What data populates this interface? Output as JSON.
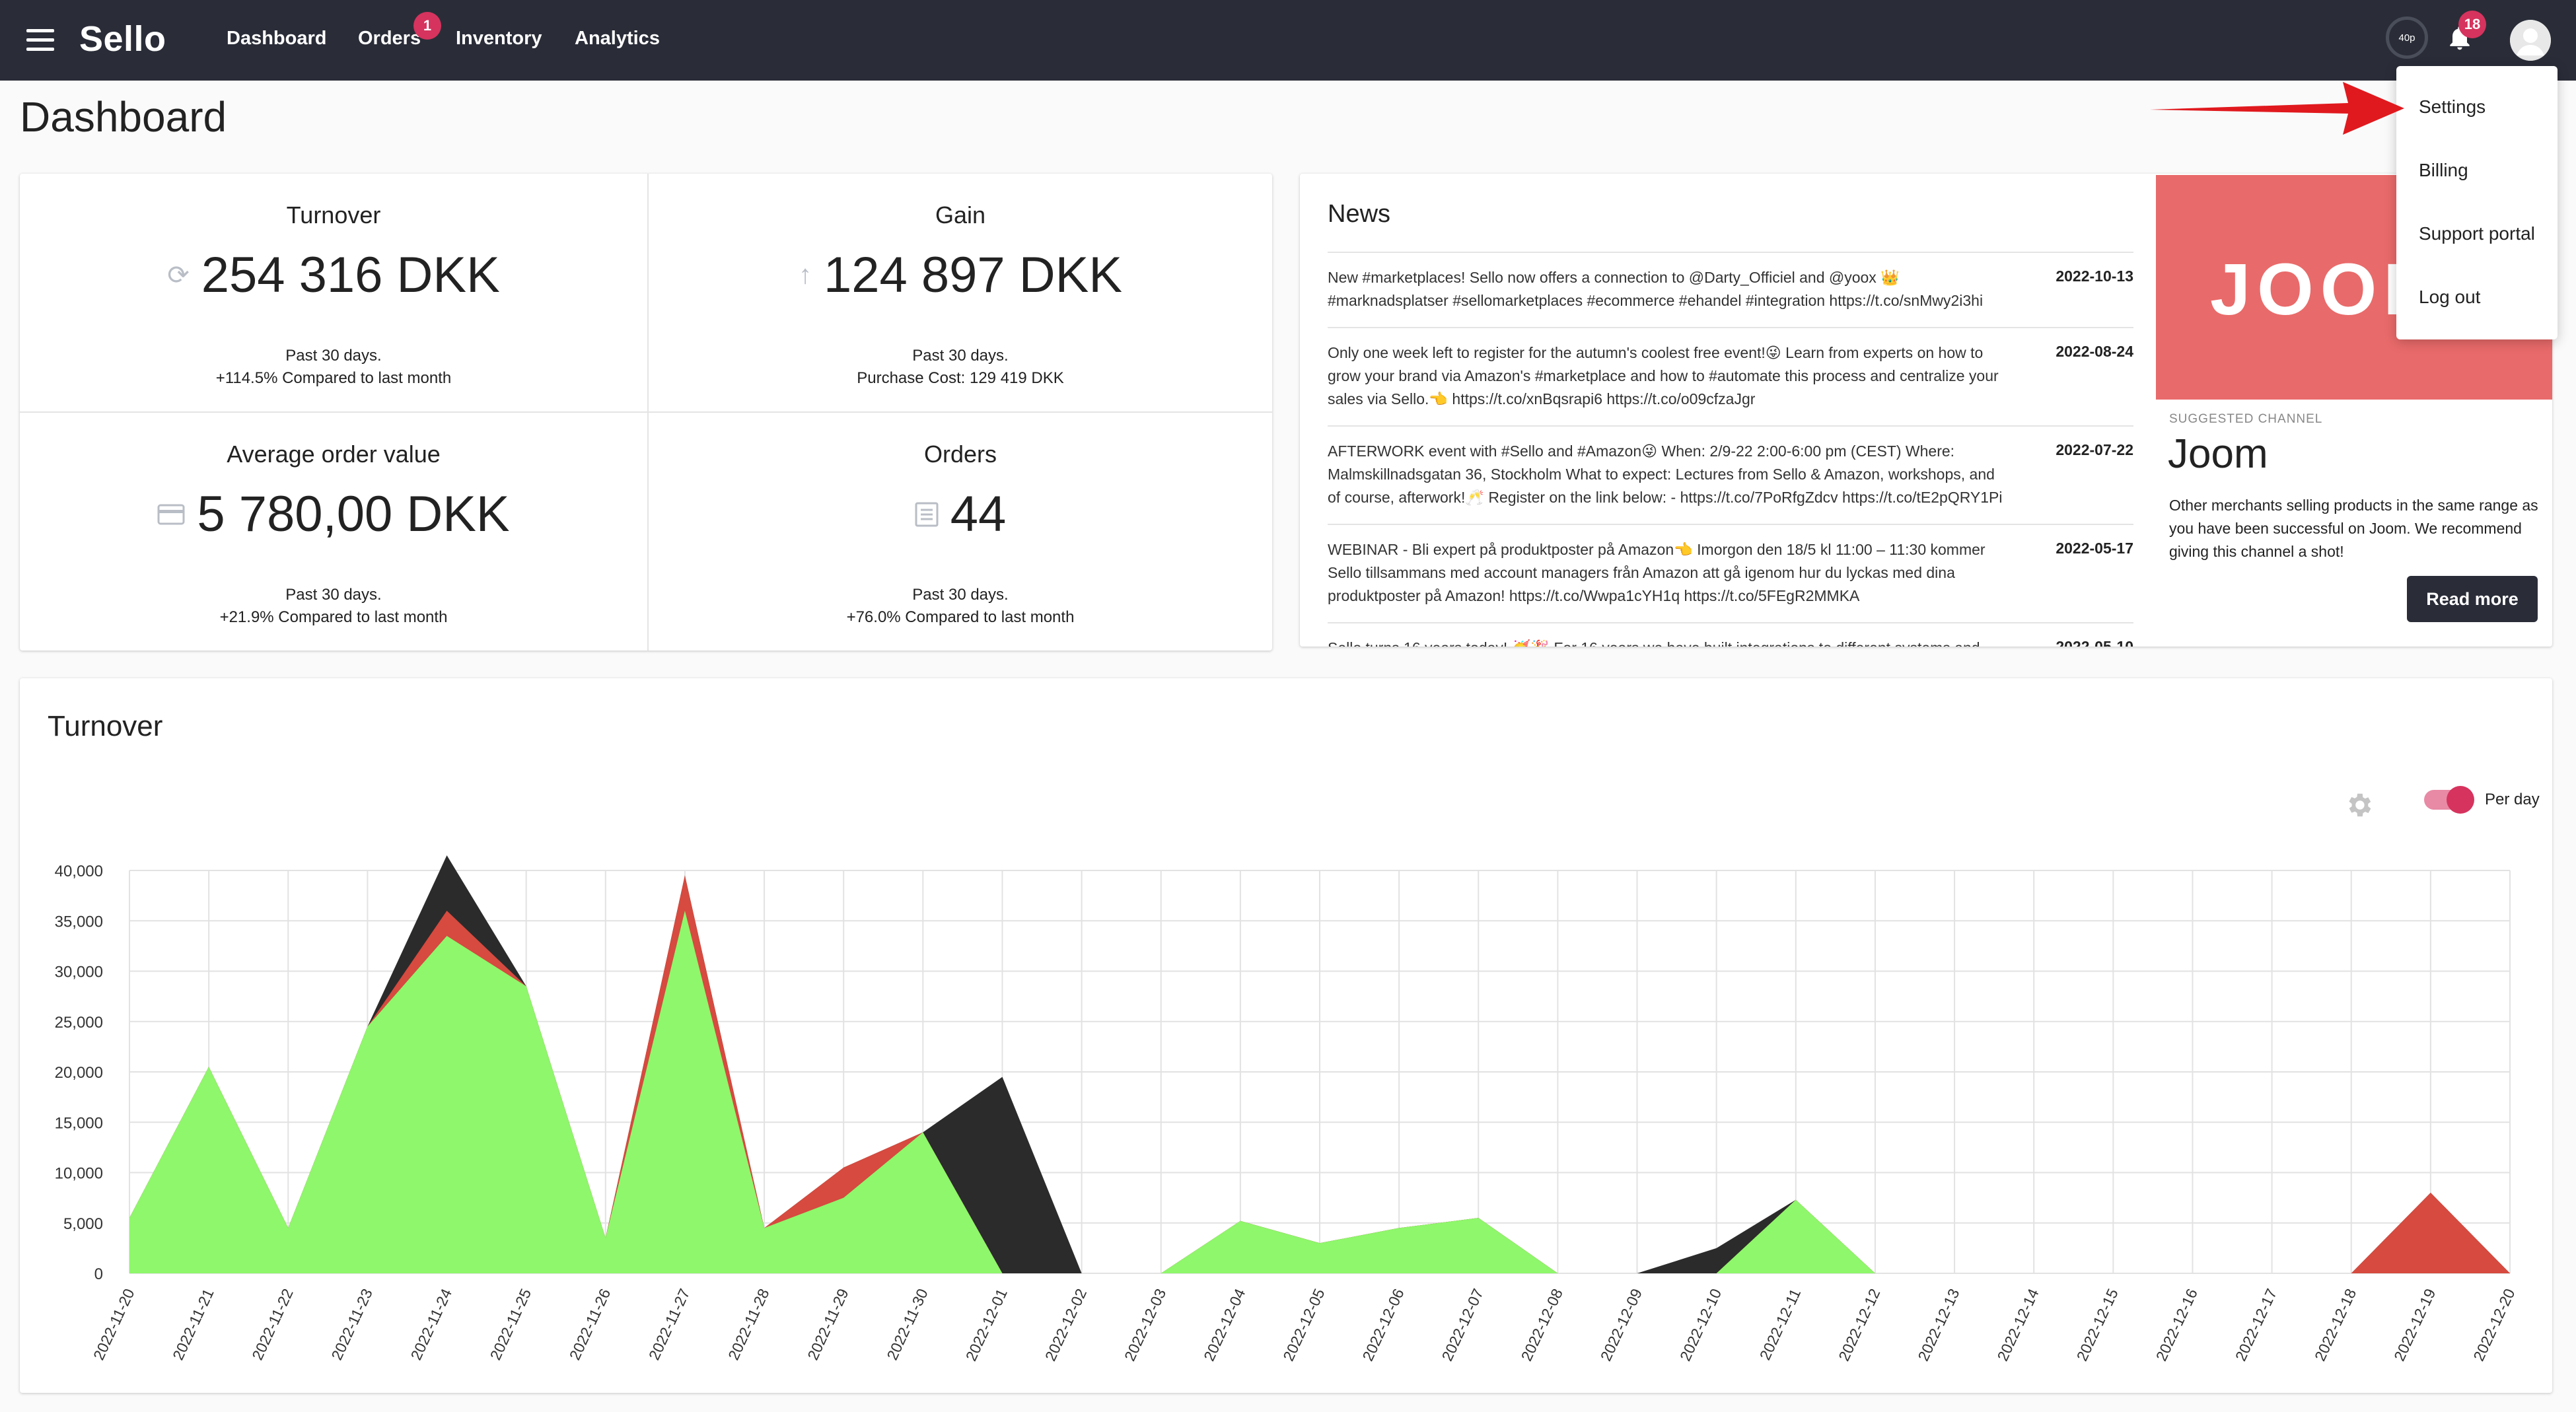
{
  "brand": "Sello",
  "nav": {
    "items": [
      {
        "label": "Dashboard"
      },
      {
        "label": "Orders",
        "badge": "1"
      },
      {
        "label": "Inventory"
      },
      {
        "label": "Analytics"
      }
    ],
    "gauge_label": "40p",
    "notifications_badge": "18"
  },
  "user_menu": {
    "items": [
      {
        "label": "Settings"
      },
      {
        "label": "Billing"
      },
      {
        "label": "Support portal"
      },
      {
        "label": "Log out"
      }
    ]
  },
  "page_title": "Dashboard",
  "stats": [
    {
      "title": "Turnover",
      "value": "254 316 DKK",
      "icon": "refresh-icon",
      "sub1": "Past 30 days.",
      "sub2": "+114.5% Compared to last month"
    },
    {
      "title": "Gain",
      "value": "124 897 DKK",
      "icon": "arrow-up-icon",
      "sub1": "Past 30 days.",
      "sub2": "Purchase Cost: 129 419 DKK"
    },
    {
      "title": "Average order value",
      "value": "5 780,00 DKK",
      "icon": "credit-card-icon",
      "sub1": "Past 30 days.",
      "sub2": "+21.9% Compared to last month"
    },
    {
      "title": "Orders",
      "value": "44",
      "icon": "receipt-icon",
      "sub1": "Past 30 days.",
      "sub2": "+76.0% Compared to last month"
    }
  ],
  "news": {
    "title": "News",
    "items": [
      {
        "text": "New #marketplaces! Sello now offers a connection to @Darty_Officiel and @yoox 👑 #marknadsplatser #sellomarketplaces #ecommerce #ehandel #integration https://t.co/snMwy2i3hi",
        "date": "2022-10-13"
      },
      {
        "text": "Only one week left to register for the autumn's coolest free event!😜 Learn from experts on how to grow your brand via Amazon's #marketplace and how to #automate this process and centralize your sales via Sello.👈 https://t.co/xnBqsrapi6 https://t.co/o09cfzaJgr",
        "date": "2022-08-24"
      },
      {
        "text": "AFTERWORK event with #Sello and #Amazon😜 When: 2/9-22 2:00-6:00 pm (CEST) Where: Malmskillnadsgatan 36, Stockholm What to expect: Lectures from Sello & Amazon, workshops, and of course, afterwork!🥂 Register on the link below: - https://t.co/7PoRfgZdcv https://t.co/tE2pQRY1Pi",
        "date": "2022-07-22"
      },
      {
        "text": "WEBINAR - Bli expert på produktposter på Amazon👈 Imorgon den 18/5 kl 11:00 – 11:30 kommer Sello tillsammans med account managers från Amazon att gå igenom hur du lyckas med dina produktposter på Amazon! https://t.co/Wwpa1cYH1q https://t.co/5FEgR2MMKA",
        "date": "2022-05-17"
      },
      {
        "text": "Sello turns 16 years today! 🥳🎉 For 16 years we have built integrations to different systems and",
        "date": "2022-05-10"
      }
    ]
  },
  "suggested": {
    "banner_text": "JOOM",
    "label": "SUGGESTED CHANNEL",
    "name": "Joom",
    "description": "Other merchants selling products in the same range as you have been successful on Joom. We recommend giving this channel a shot!",
    "button": "Read more"
  },
  "chart_title": "Turnover",
  "toggle_label": "Per day",
  "colors": {
    "nav_bg": "#2a2d38",
    "accent": "#d6335e",
    "green": "#8ef76b",
    "red": "#d64a3f",
    "black": "#2b2b2b",
    "joom": "#e96a6a"
  },
  "chart_data": {
    "type": "area",
    "categories": [
      "2022-11-20",
      "2022-11-21",
      "2022-11-22",
      "2022-11-23",
      "2022-11-24",
      "2022-11-25",
      "2022-11-26",
      "2022-11-27",
      "2022-11-28",
      "2022-11-29",
      "2022-11-30",
      "2022-12-01",
      "2022-12-02",
      "2022-12-03",
      "2022-12-04",
      "2022-12-05",
      "2022-12-06",
      "2022-12-07",
      "2022-12-08",
      "2022-12-09",
      "2022-12-10",
      "2022-12-11",
      "2022-12-12",
      "2022-12-13",
      "2022-12-14",
      "2022-12-15",
      "2022-12-16",
      "2022-12-17",
      "2022-12-18",
      "2022-12-19",
      "2022-12-20"
    ],
    "yticks": [
      "0",
      "5,000",
      "10,000",
      "15,000",
      "20,000",
      "25,000",
      "30,000",
      "35,000",
      "40,000"
    ],
    "ylim": [
      0,
      40000
    ],
    "grid": true,
    "series": [
      {
        "color": "#2b2b2b",
        "values": [
          5500,
          20500,
          4500,
          24500,
          41500,
          28500,
          3500,
          39500,
          4500,
          10500,
          14000,
          19500,
          0,
          0,
          5200,
          3000,
          4500,
          5500,
          0,
          0,
          2500,
          7300,
          0,
          0,
          0,
          0,
          0,
          0,
          0,
          8000,
          0
        ]
      },
      {
        "color": "#d64a3f",
        "values": [
          5500,
          20500,
          4500,
          24500,
          36000,
          28500,
          3500,
          39500,
          4500,
          10500,
          14000,
          0,
          0,
          0,
          5200,
          3000,
          4500,
          5500,
          0,
          0,
          0,
          7300,
          0,
          0,
          0,
          0,
          0,
          0,
          0,
          8000,
          0
        ]
      },
      {
        "color": "#8ef76b",
        "values": [
          5500,
          20500,
          4500,
          24500,
          33500,
          28500,
          3500,
          36000,
          4500,
          7500,
          14000,
          0,
          0,
          0,
          5200,
          3000,
          4500,
          5500,
          0,
          0,
          0,
          7300,
          0,
          0,
          0,
          0,
          0,
          0,
          0,
          0,
          0
        ]
      }
    ]
  }
}
